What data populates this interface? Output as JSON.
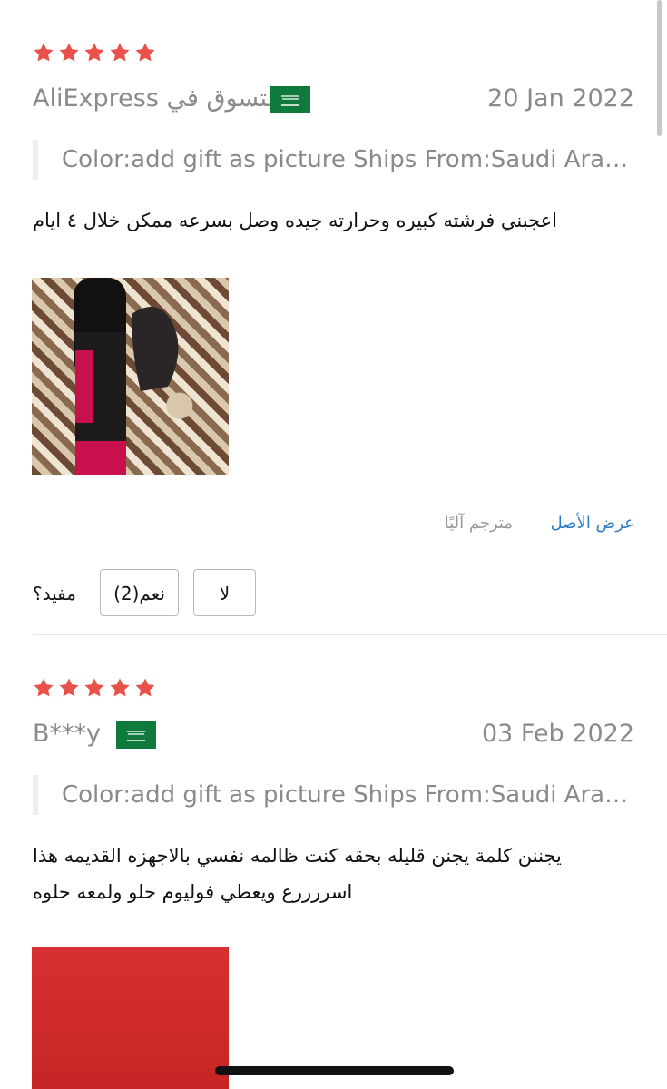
{
  "reviews": [
    {
      "rating": 5,
      "reviewer": "AliExpress المتسوق في",
      "country_flag": "saudi-arabia-flag",
      "date": "20 Jan 2022",
      "sku": "Color:add gift as picture Ships From:Saudi Arabia",
      "comment": "اعجبني فرشته كبيره وحرارته جيده وصل بسرعه ممكن خلال ٤ ايام",
      "translation": {
        "view_original": "عرض الأصل",
        "auto_translated": "مترجم آليًا"
      },
      "helpful": {
        "label": "مفيد؟",
        "yes": "نعم(2)",
        "no": "لا"
      }
    },
    {
      "rating": 5,
      "reviewer": "B***y",
      "country_flag": "saudi-arabia-flag",
      "date": "03 Feb 2022",
      "sku": "Color:add gift as picture Ships From:Saudi Arabia",
      "comment_line1": "يجننن كلمة يجنن قليله بحقه كنت ظالمه نفسي بالاجهزه القديمه هذا",
      "comment_line2": "اسررررع ويعطي فوليوم حلو ولمعه حلوه"
    }
  ],
  "colors": {
    "star": "#e8524a",
    "link": "#2d7cc1",
    "muted": "#8a8a8a"
  }
}
